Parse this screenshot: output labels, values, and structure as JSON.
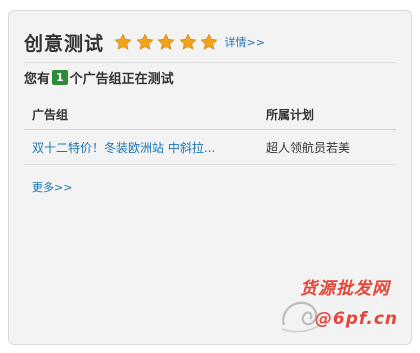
{
  "header": {
    "title": "创意测试",
    "rating": 5,
    "rating_max": 5,
    "details_link": "详情>>"
  },
  "summary": {
    "prefix": "您有",
    "count": "1",
    "suffix": "个广告组正在测试"
  },
  "table": {
    "columns": [
      "广告组",
      "所属计划"
    ],
    "rows": [
      {
        "ad_group": "双十二特价！冬装欧洲站 中斜拉...",
        "plan": "超人领航员若美"
      }
    ]
  },
  "more_link": "更多>>",
  "watermark": {
    "title": "货源批发网",
    "url": "@6pf.cn"
  },
  "colors": {
    "link": "#1a74b4",
    "badge": "#2f8a37",
    "star": "#f3a21b",
    "watermark": "#e5463a"
  }
}
